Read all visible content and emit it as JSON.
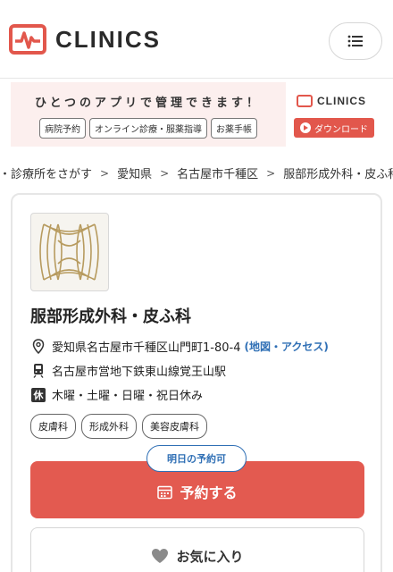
{
  "header": {
    "brand": "CLINICS",
    "menu_icon": "hamburger-menu-icon"
  },
  "banner": {
    "title": "ひとつのアプリで管理できます！",
    "tags": [
      "病院予約",
      "オンライン診療・服薬指導",
      "お薬手帳"
    ],
    "brand": "CLINICS",
    "download_label": "ダウンロード"
  },
  "breadcrumb": {
    "items": [
      "院・診療所をさがす",
      "愛知県",
      "名古屋市千種区",
      "服部形成外科・皮ふ科"
    ]
  },
  "clinic": {
    "name": "服部形成外科・皮ふ科",
    "address": "愛知県名古屋市千種区山門町1-80-4",
    "map_link": "(地図・アクセス)",
    "station": "名古屋市営地下鉄東山線覚王山駅",
    "holiday_badge": "休",
    "holidays": "木曜・土曜・日曜・祝日休み",
    "tags": [
      "皮膚科",
      "形成外科",
      "美容皮膚科"
    ]
  },
  "actions": {
    "availability": "明日の予約可",
    "reserve_label": "予約する",
    "favorite_label": "お気に入り"
  },
  "colors": {
    "brand_red": "#e2574c",
    "link_blue": "#2f6fb5"
  }
}
